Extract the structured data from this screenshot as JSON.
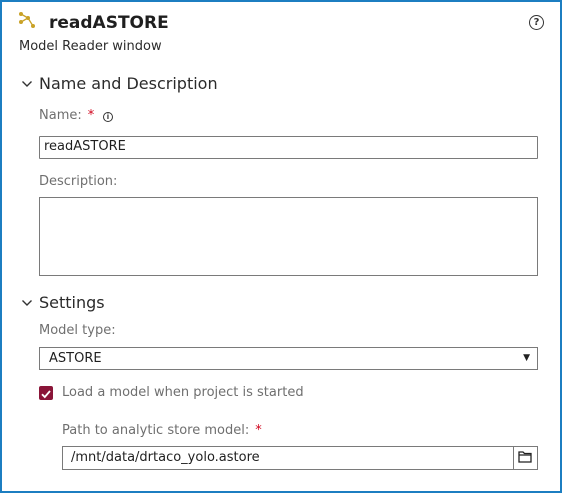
{
  "header": {
    "title": "readASTORE",
    "subtitle": "Model Reader window",
    "icon": "model-reader-icon",
    "help_glyph": "?"
  },
  "name_section": {
    "title": "Name and Description",
    "name_label": "Name:",
    "name_required": "*",
    "name_value": "readASTORE",
    "description_label": "Description:",
    "description_value": ""
  },
  "settings_section": {
    "title": "Settings",
    "model_type_label": "Model type:",
    "model_type_value": "ASTORE",
    "load_checkbox_label": "Load a model when project is started",
    "load_checked": true,
    "path_label": "Path to analytic store model:",
    "path_required": "*",
    "path_value": "/mnt/data/drtaco_yolo.astore"
  },
  "colors": {
    "accent_border": "#1c7ec1",
    "checkbox": "#8a1538",
    "required": "#d0021b"
  }
}
